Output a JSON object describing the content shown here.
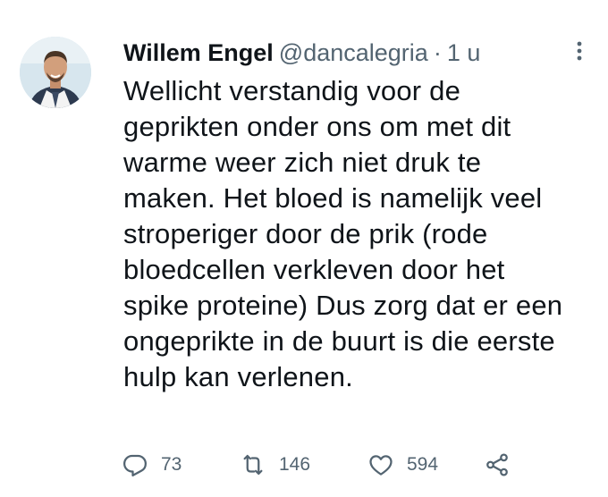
{
  "author": {
    "name": "Willem Engel",
    "handle": "@dancalegria",
    "separator": "·",
    "time": "1 u"
  },
  "tweet": {
    "lines": [
      "Wellicht verstandig voor de",
      "geprikten onder ons om met dit",
      "warme weer zich niet druk te",
      "maken. Het bloed is namelijk veel",
      "stroperiger door de prik (rode",
      "bloedcellen verkleven door het",
      "spike proteine) Dus zorg dat er een",
      "ongeprikte in de buurt is die eerste",
      "hulp kan verlenen."
    ]
  },
  "actions": {
    "replies": "73",
    "retweets": "146",
    "likes": "594"
  },
  "icons": {
    "avatar": "profile-photo",
    "more": "more-vertical-icon",
    "reply": "reply-icon",
    "retweet": "retweet-icon",
    "like": "heart-icon",
    "share": "share-icon"
  },
  "colors": {
    "text": "#0f1419",
    "secondary": "#536471",
    "background": "#ffffff"
  }
}
